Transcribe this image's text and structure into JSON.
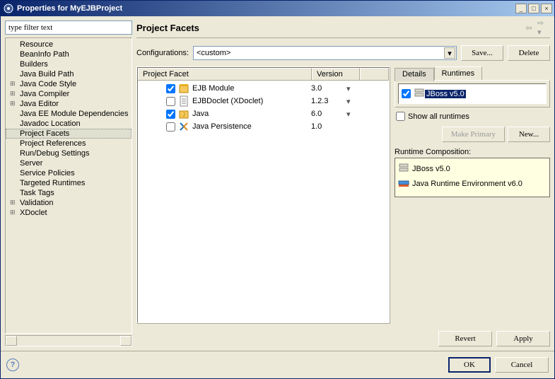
{
  "window": {
    "title": "Properties for MyEJBProject"
  },
  "filter": {
    "placeholder": "type filter text"
  },
  "tree": {
    "items": [
      {
        "label": "Resource",
        "exp": false
      },
      {
        "label": "BeanInfo Path",
        "exp": false
      },
      {
        "label": "Builders",
        "exp": false
      },
      {
        "label": "Java Build Path",
        "exp": false
      },
      {
        "label": "Java Code Style",
        "exp": true
      },
      {
        "label": "Java Compiler",
        "exp": true
      },
      {
        "label": "Java Editor",
        "exp": true
      },
      {
        "label": "Java EE Module Dependencies",
        "exp": false
      },
      {
        "label": "Javadoc Location",
        "exp": false
      },
      {
        "label": "Project Facets",
        "exp": false,
        "selected": true
      },
      {
        "label": "Project References",
        "exp": false
      },
      {
        "label": "Run/Debug Settings",
        "exp": false
      },
      {
        "label": "Server",
        "exp": false
      },
      {
        "label": "Service Policies",
        "exp": false
      },
      {
        "label": "Targeted Runtimes",
        "exp": false
      },
      {
        "label": "Task Tags",
        "exp": false
      },
      {
        "label": "Validation",
        "exp": true
      },
      {
        "label": "XDoclet",
        "exp": true
      }
    ]
  },
  "page": {
    "title": "Project Facets"
  },
  "config": {
    "label": "Configurations:",
    "value": "<custom>",
    "save": "Save...",
    "delete": "Delete"
  },
  "facets": {
    "headers": {
      "name": "Project Facet",
      "version": "Version"
    },
    "rows": [
      {
        "checked": true,
        "icon": "ejb",
        "label": "EJB Module",
        "version": "3.0",
        "dropdown": true
      },
      {
        "checked": false,
        "icon": "doc",
        "label": "EJBDoclet (XDoclet)",
        "version": "1.2.3",
        "dropdown": true
      },
      {
        "checked": true,
        "icon": "java",
        "label": "Java",
        "version": "6.0",
        "dropdown": true
      },
      {
        "checked": false,
        "icon": "jpa",
        "label": "Java Persistence",
        "version": "1.0",
        "dropdown": false
      }
    ]
  },
  "tabs": {
    "details": "Details",
    "runtimes": "Runtimes"
  },
  "runtimes": {
    "items": [
      {
        "checked": true,
        "label": "JBoss v5.0"
      }
    ],
    "show_all": "Show all runtimes",
    "make_primary": "Make Primary",
    "new": "New...",
    "composition_label": "Runtime Composition:",
    "composition": [
      {
        "icon": "server",
        "label": "JBoss v5.0"
      },
      {
        "icon": "jre",
        "label": "Java Runtime Environment v6.0"
      }
    ]
  },
  "footer": {
    "revert": "Revert",
    "apply": "Apply"
  },
  "dialog": {
    "ok": "OK",
    "cancel": "Cancel"
  }
}
